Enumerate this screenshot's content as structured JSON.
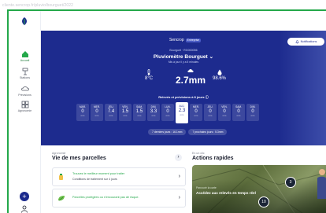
{
  "browser": {
    "url": "cliente.sencrop.fr/pluvio/bourguet/2022"
  },
  "sidebar": {
    "items": [
      {
        "label": "Accueil",
        "icon": "home-icon"
      },
      {
        "label": "Stations",
        "icon": "station-icon"
      },
      {
        "label": "Prévisions",
        "icon": "forecast-icon"
      },
      {
        "label": "Agronomie",
        "icon": "agronomy-icon"
      }
    ],
    "add_label": "+"
  },
  "hero": {
    "brand": "Sencrop",
    "brand_badge": "Entreprise",
    "notifications_label": "Notifications",
    "station_id": "Bourguet · RG000056",
    "station_name": "Pluviomètre Bourguet",
    "station_status": "Mis à jour il y a 5 minutes",
    "temperature": "8°C",
    "rain": "2.7mm",
    "humidity": "98.6%",
    "rain_title": "Relevés et prévisions à 8 jours",
    "days": [
      {
        "name": "MAR.",
        "value": "0",
        "unit": "mm"
      },
      {
        "name": "MER.",
        "value": "0",
        "unit": "mm"
      },
      {
        "name": "JEU.",
        "value": "7.4",
        "unit": "mm"
      },
      {
        "name": "VEN.",
        "value": "1.5",
        "unit": "mm"
      },
      {
        "name": "SAM.",
        "value": "1.5",
        "unit": "mm"
      },
      {
        "name": "DIM.",
        "value": "3.3",
        "unit": "mm"
      },
      {
        "name": "LUN.",
        "value": "0",
        "unit": "mm"
      },
      {
        "name": "AUJ.",
        "value": "2.3",
        "unit": "mm",
        "today": true
      },
      {
        "name": "MER.",
        "value": "0",
        "unit": "mm"
      },
      {
        "name": "JEU.",
        "value": "0",
        "unit": "mm"
      },
      {
        "name": "VEN.",
        "value": "0",
        "unit": "mm"
      },
      {
        "name": "SAM.",
        "value": "0",
        "unit": "mm"
      },
      {
        "name": "DIM.",
        "value": "0",
        "unit": "mm"
      }
    ],
    "total_past": "7 derniers jours : 16.1mm",
    "total_future": "7 prochains jours : 5.3mm"
  },
  "parcels": {
    "small": "Agronomie",
    "title": "Vie de mes parcelles",
    "cards": [
      {
        "title": "Trouvez le meilleur moment pour traiter",
        "text": "Conditions de traitement sur 4 jours"
      },
      {
        "title": "Parcelles protégées ou n'encourant pas de risque.",
        "text": ""
      }
    ]
  },
  "actions": {
    "small": "En un clic",
    "title": "Actions rapides",
    "card_small": "Parcourir la carte",
    "card_text": "Accédez aux relevés en temps réel",
    "badge_a": "3",
    "badge_b": "10"
  },
  "colors": {
    "primary": "#1d2b8e",
    "accent_green": "#24a84a"
  }
}
